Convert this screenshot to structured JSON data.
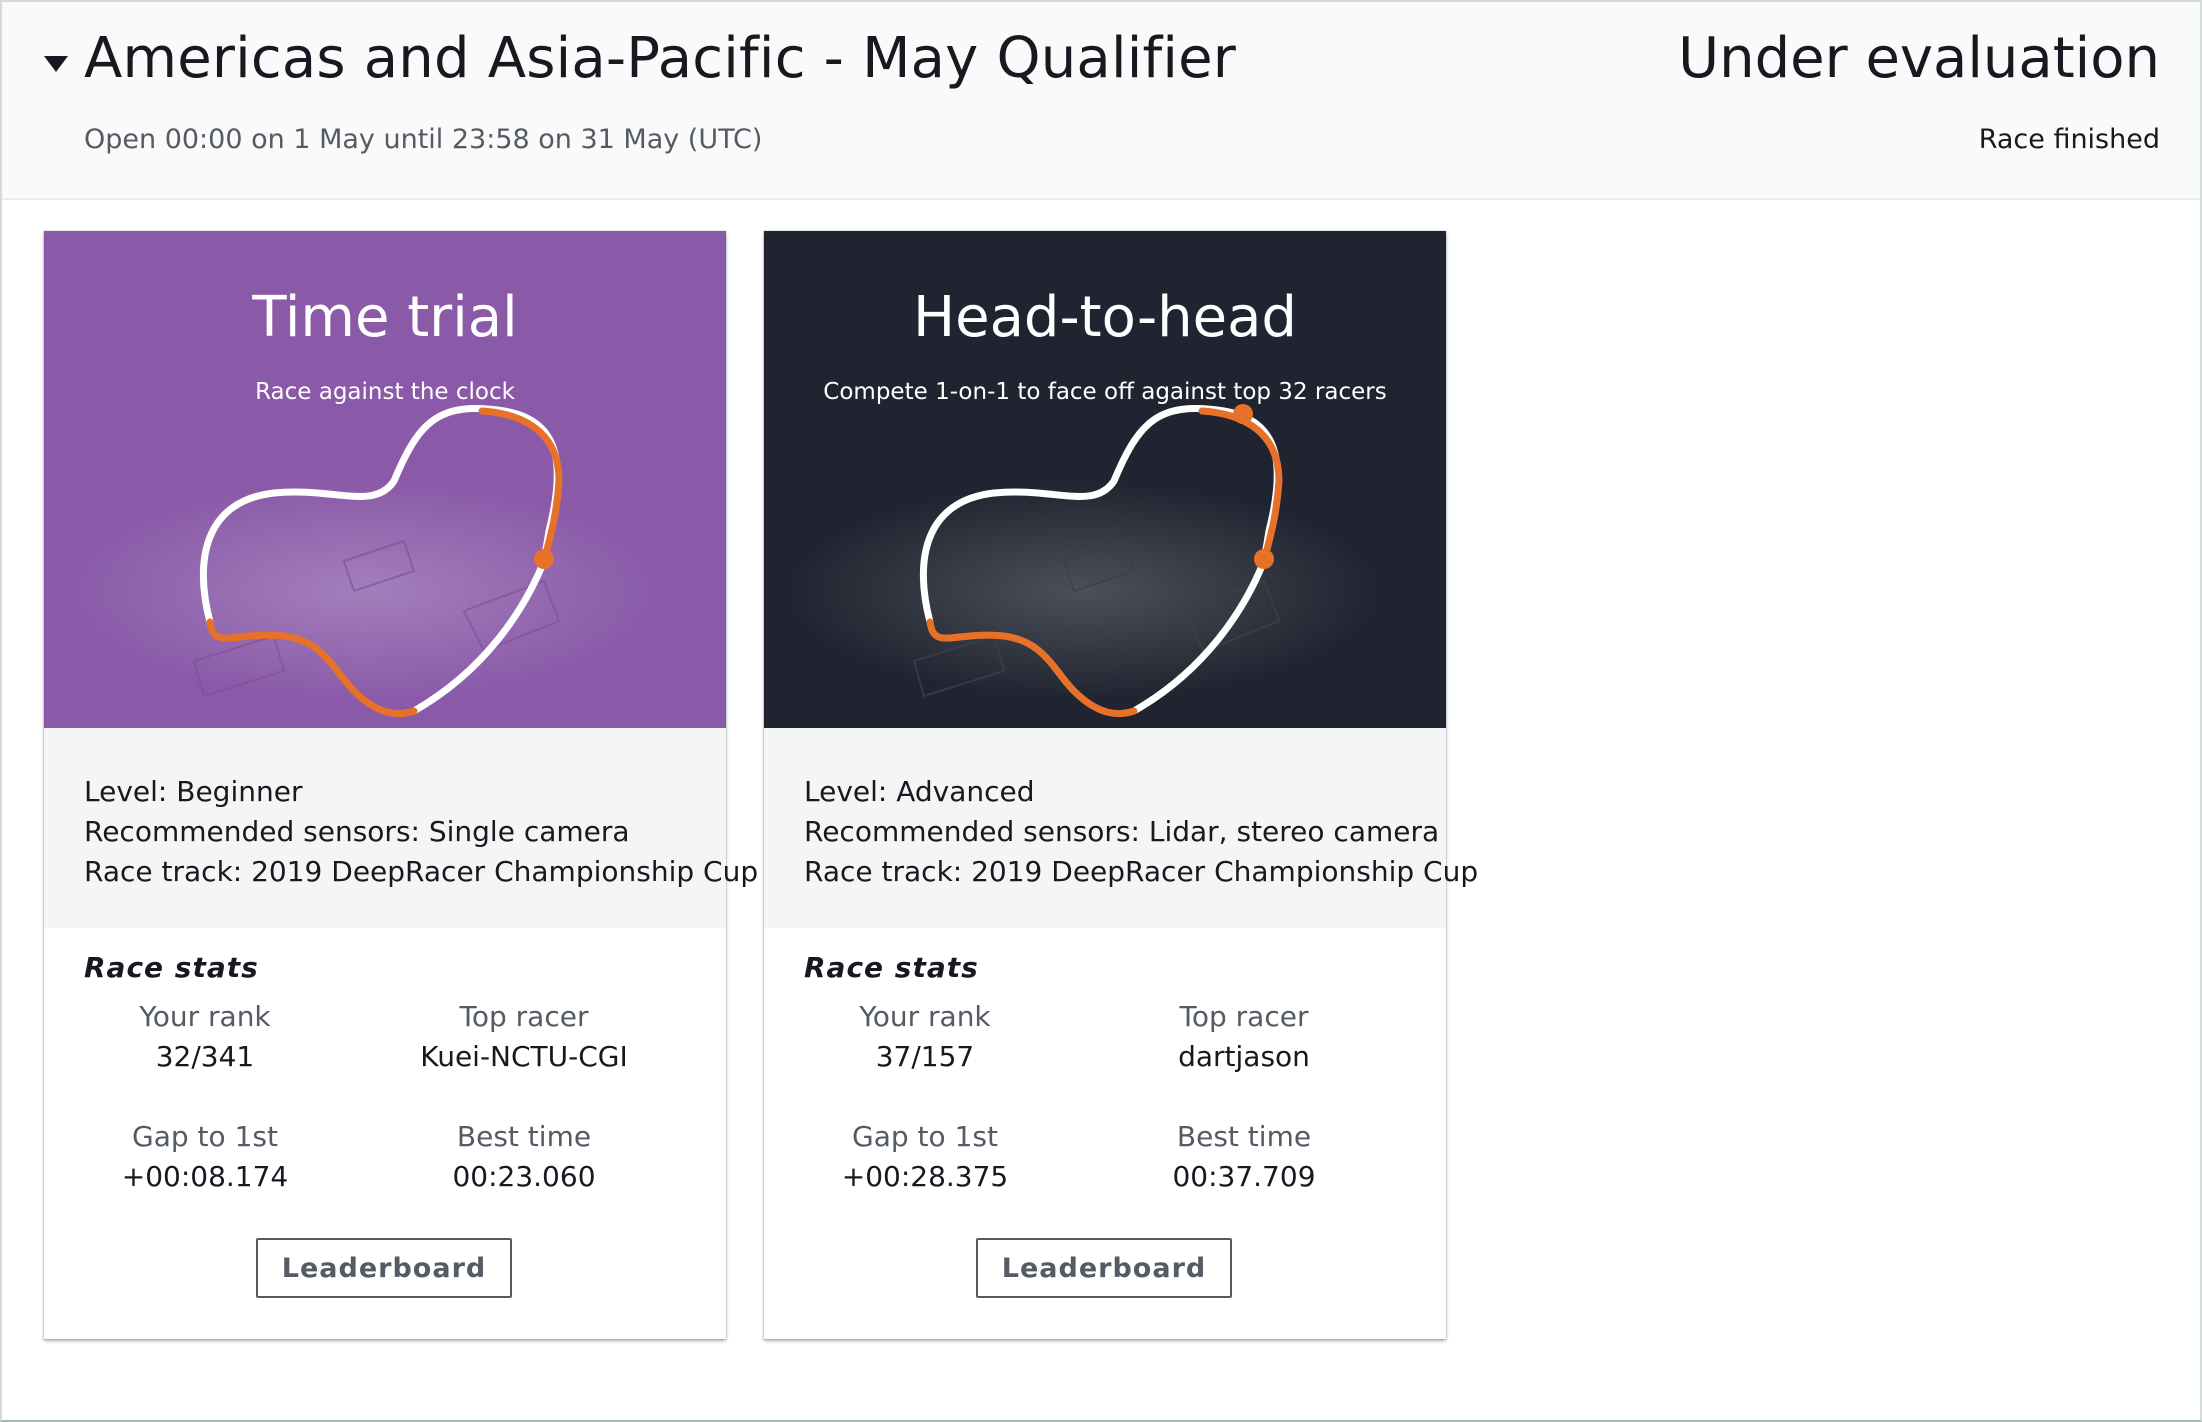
{
  "header": {
    "title": "Americas and Asia-Pacific - May Qualifier",
    "subtitle": "Open 00:00 on 1 May until 23:58 on 31 May (UTC)",
    "status": "Under evaluation",
    "status_detail": "Race finished"
  },
  "colors": {
    "time_trial_bg": "#8a5aa8",
    "head_to_head_bg": "#1f2430",
    "track_accent": "#e8712a",
    "track_line": "#ffffff"
  },
  "cards": [
    {
      "title": "Time trial",
      "subtitle": "Race against the clock",
      "level": "Level: Beginner",
      "sensors": "Recommended sensors: Single camera",
      "track": "Race track: 2019 DeepRacer Championship Cup",
      "stats_title": "Race stats",
      "rank_label": "Your rank",
      "rank_value": "32/341",
      "top_racer_label": "Top racer",
      "top_racer_value": "Kuei-NCTU-CGI",
      "gap_label": "Gap to 1st",
      "gap_value": "+00:08.174",
      "best_label": "Best time",
      "best_value": "00:23.060",
      "button": "Leaderboard"
    },
    {
      "title": "Head-to-head",
      "subtitle": "Compete 1-on-1 to face off against top 32 racers",
      "level": "Level: Advanced",
      "sensors": "Recommended sensors: Lidar, stereo camera",
      "track": "Race track: 2019 DeepRacer Championship Cup",
      "stats_title": "Race stats",
      "rank_label": "Your rank",
      "rank_value": "37/157",
      "top_racer_label": "Top racer",
      "top_racer_value": "dartjason",
      "gap_label": "Gap to 1st",
      "gap_value": "+00:28.375",
      "best_label": "Best time",
      "best_value": "00:37.709",
      "button": "Leaderboard"
    }
  ]
}
